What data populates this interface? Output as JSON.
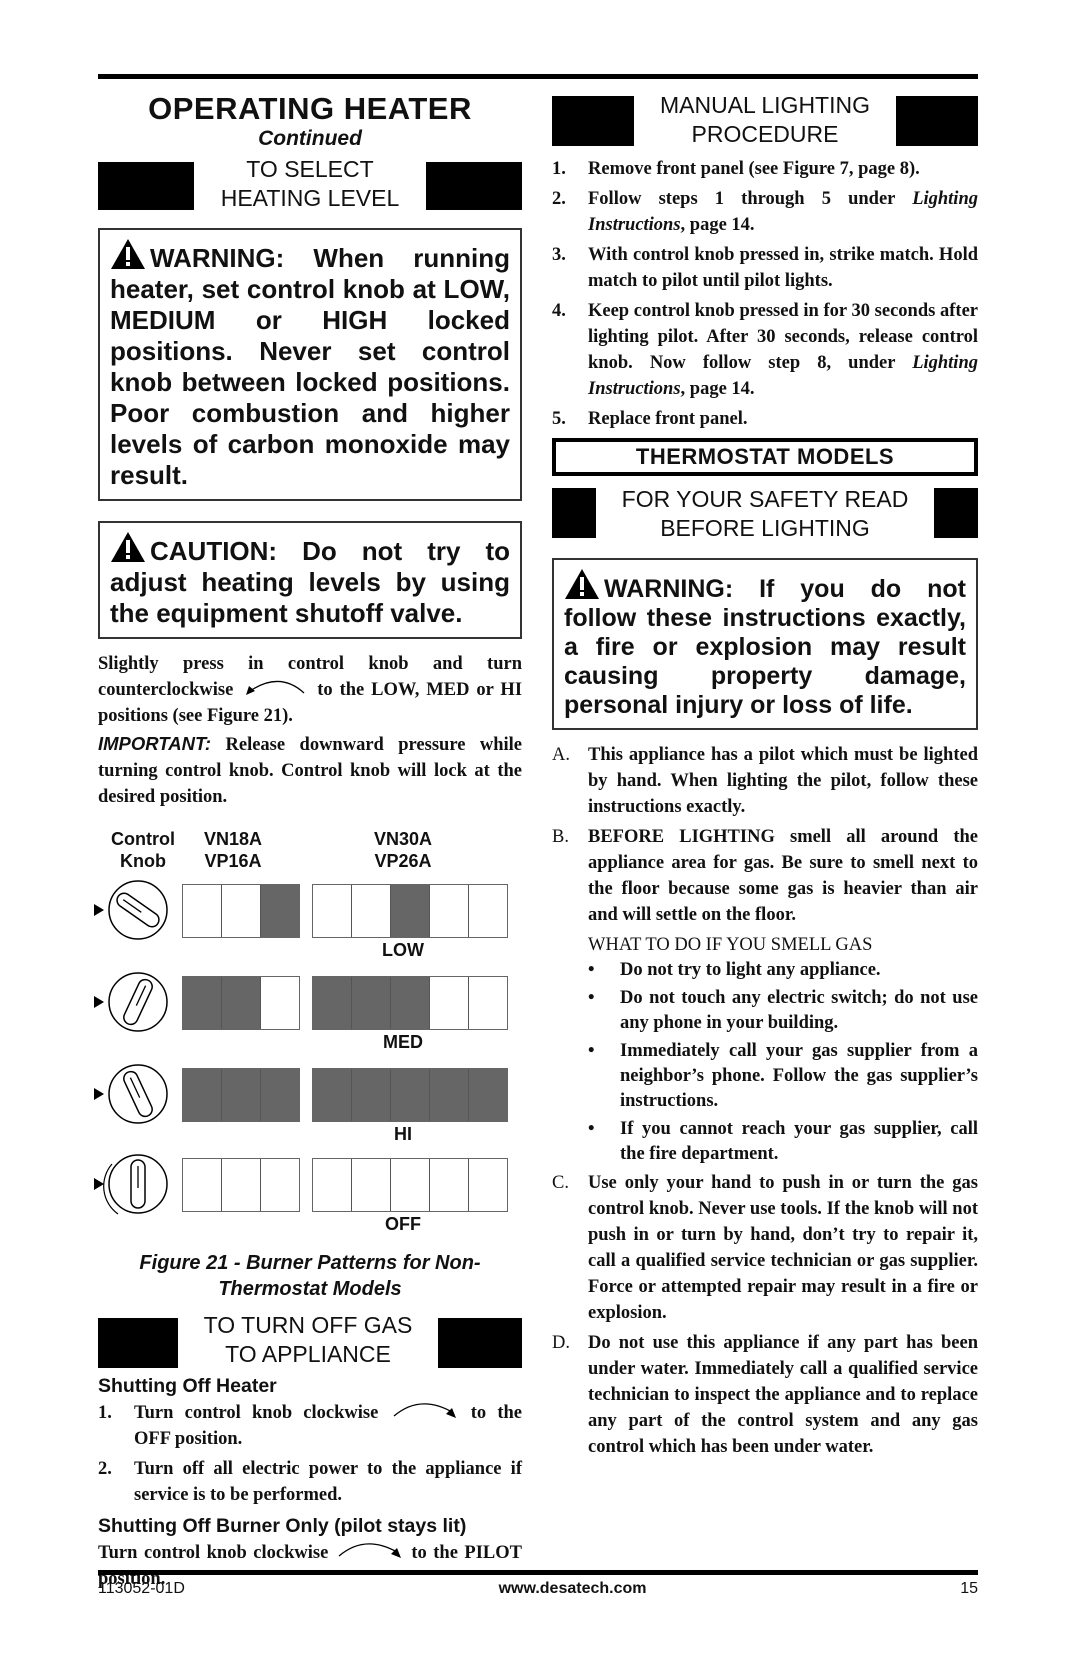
{
  "page": {
    "title": "OPERATING HEATER",
    "subtitle": "Continued",
    "footer": {
      "doc_number": "113052-01D",
      "url": "www.desatech.com",
      "page_number": "15"
    }
  },
  "left": {
    "select_header": {
      "line1": "TO SELECT",
      "line2": "HEATING LEVEL"
    },
    "warning": "WARNING: When running heater, set control knob at LOW, MEDIUM or HIGH locked positions. Never set control knob between locked positions. Poor combustion and higher levels of carbon monoxide may result.",
    "caution": "CAUTION: Do not try to adjust heating levels by using the equipment shutoff valve.",
    "para1_a": "Slightly press in control knob and turn counterclockwise",
    "para1_b": "to the LOW, MED or HI positions (see Figure 21).",
    "important_label": "IMPORTANT:",
    "important_text": "Release downward pressure while turning control knob. Control knob will lock at the desired position.",
    "figure": {
      "col_knob": {
        "line1": "Control",
        "line2": "Knob"
      },
      "col_a": {
        "line1": "VN18A",
        "line2": "VP16A"
      },
      "col_b": {
        "line1": "VN30A",
        "line2": "VP26A"
      },
      "rows": [
        {
          "level": "LOW",
          "a": [
            0,
            0,
            1
          ],
          "b": [
            0,
            0,
            1,
            0,
            0
          ]
        },
        {
          "level": "MED",
          "a": [
            1,
            1,
            0
          ],
          "b": [
            1,
            1,
            1,
            0,
            0
          ]
        },
        {
          "level": "HI",
          "a": [
            1,
            1,
            1
          ],
          "b": [
            1,
            1,
            1,
            1,
            1
          ]
        },
        {
          "level": "OFF",
          "a": [
            0,
            0,
            0
          ],
          "b": [
            0,
            0,
            0,
            0,
            0
          ]
        }
      ],
      "caption_line1": "Figure 21 - Burner Patterns for Non-",
      "caption_line2": "Thermostat Models"
    },
    "turnoff_header": {
      "line1": "TO TURN OFF GAS",
      "line2": "TO APPLIANCE"
    },
    "shut_heater_title": "Shutting Off Heater",
    "shut_heater_steps": [
      {
        "num": "1.",
        "text_a": "Turn control knob clockwise",
        "text_b": "to the OFF position."
      },
      {
        "num": "2.",
        "text": "Turn off all electric power to the appliance if service is to be performed."
      }
    ],
    "shut_burner_title": "Shutting Off Burner Only (pilot stays lit)",
    "shut_burner_a": "Turn control knob clockwise",
    "shut_burner_b": "to the PILOT position."
  },
  "right": {
    "manual_header": {
      "line1": "MANUAL LIGHTING",
      "line2": "PROCEDURE"
    },
    "manual_steps": [
      {
        "num": "1.",
        "text": "Remove front panel (see Figure 7, page 8)."
      },
      {
        "num": "2.",
        "text_a": "Follow steps 1 through 5 under ",
        "italic": "Lighting Instructions",
        "text_b": ", page 14."
      },
      {
        "num": "3.",
        "text": "With control knob pressed in, strike match. Hold match to pilot until pilot lights."
      },
      {
        "num": "4.",
        "text_a": "Keep control knob pressed in for 30 seconds after lighting pilot. After 30 seconds, release control knob. Now follow step 8, under ",
        "italic": "Lighting Instructions",
        "text_b": ", page 14."
      },
      {
        "num": "5.",
        "text": "Replace front panel."
      }
    ],
    "thermostat_title": "THERMOSTAT MODELS",
    "safety_header": {
      "line1": "FOR YOUR SAFETY READ",
      "line2": "BEFORE LIGHTING"
    },
    "warning": "WARNING: If you do not follow these instructions exactly, a fire or explosion may result causing property damage, personal injury or loss of life.",
    "items": [
      {
        "letter": "A.",
        "text": "This appliance has a pilot which must be lighted by hand. When lighting the pilot, follow these instructions exactly."
      },
      {
        "letter": "B.",
        "text": "BEFORE LIGHTING smell all around the appliance area for gas. Be sure to smell next to the floor because some gas is heavier than air and will settle on the floor."
      }
    ],
    "smell_title": "WHAT TO DO IF YOU SMELL GAS",
    "bullets": [
      "Do not try to light any appliance.",
      "Do not touch any electric switch; do not use any phone in your building.",
      "Immediately call your gas supplier from a neighbor’s phone. Follow the gas supplier’s instructions.",
      "If you cannot reach your gas supplier, call the fire department."
    ],
    "items2": [
      {
        "letter": "C.",
        "text": "Use only your hand to push in or turn the gas control knob. Never use tools. If the knob will not push in or turn by hand, don’t try to repair it, call a qualified service technician or gas supplier. Force or attempted repair may result in a fire or explosion."
      },
      {
        "letter": "D.",
        "text": "Do not use this appliance if any part has been under water. Immediately call a qualified service technician to inspect the appliance and to replace any part of the control system and any gas control which has been under water."
      }
    ]
  }
}
